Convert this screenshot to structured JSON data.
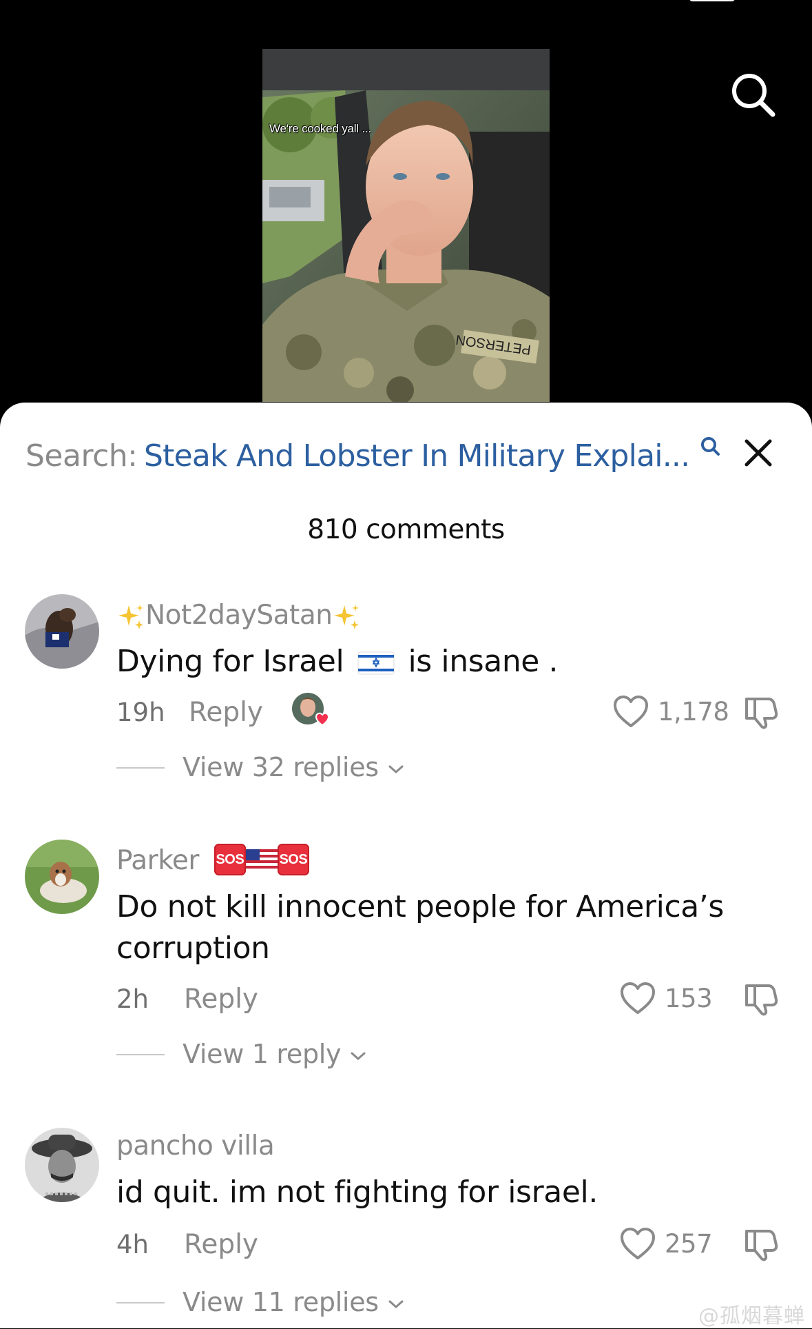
{
  "video": {
    "caption": "We're cooked yall ..."
  },
  "sheet": {
    "search_label": "Search:",
    "search_query": "Steak And Lobster In Military Explai...",
    "comment_count": "810 comments"
  },
  "comments": [
    {
      "username": "Not2daySatan",
      "text_before_flag": "Dying for Israel",
      "text_after_flag": "is insane .",
      "time": "19h",
      "reply_label": "Reply",
      "likes": "1,178",
      "view_replies": "View 32 replies"
    },
    {
      "username": "Parker",
      "badge_left": "SOS",
      "badge_right": "SOS",
      "text_line1": "Do not kill innocent people for America’s",
      "text_line2": "corruption",
      "time": "2h",
      "reply_label": "Reply",
      "likes": "153",
      "view_replies": "View 1 reply"
    },
    {
      "username": "pancho villa",
      "text": "id quit. im not fighting for israel.",
      "time": "4h",
      "reply_label": "Reply",
      "likes": "257",
      "view_replies": "View 11 replies"
    }
  ],
  "watermark": "@孤烟暮蝉",
  "colors": {
    "search_query": "#2c5fa0",
    "secondary_text": "#8a8a8a",
    "heart_badge": "#f2304f",
    "sos_badge": "#e8303c"
  },
  "icons": {
    "top_right": "search-icon",
    "sheet_close": "close-icon",
    "like": "heart-outline-icon",
    "dislike": "thumbs-down-icon",
    "expand": "chevron-down-icon"
  }
}
